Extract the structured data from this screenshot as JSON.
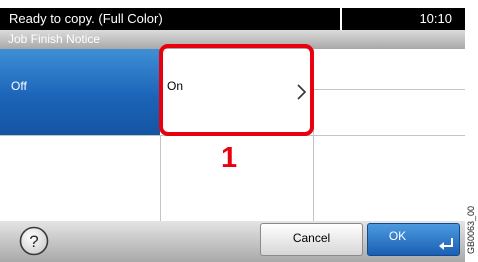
{
  "status_bar": {
    "message": "Ready to copy. (Full Color)",
    "time": "10:10"
  },
  "title_bar": {
    "title": "Job Finish Notice"
  },
  "options": [
    {
      "label": "Off",
      "selected": true
    },
    {
      "label": "On",
      "selected": false,
      "icon": "chevron-right-icon"
    }
  ],
  "callout": {
    "number": "1"
  },
  "bottom_bar": {
    "help_icon": "help-icon",
    "cancel_label": "Cancel",
    "ok_label": "OK",
    "ok_icon": "enter-icon"
  },
  "side_code": "GB0063_00",
  "colors": {
    "selected_blue": "#1c64b8",
    "highlight_red": "#e8000f",
    "status_bar_bg": "#000000",
    "title_bar_bg": "#b8b8b8"
  }
}
